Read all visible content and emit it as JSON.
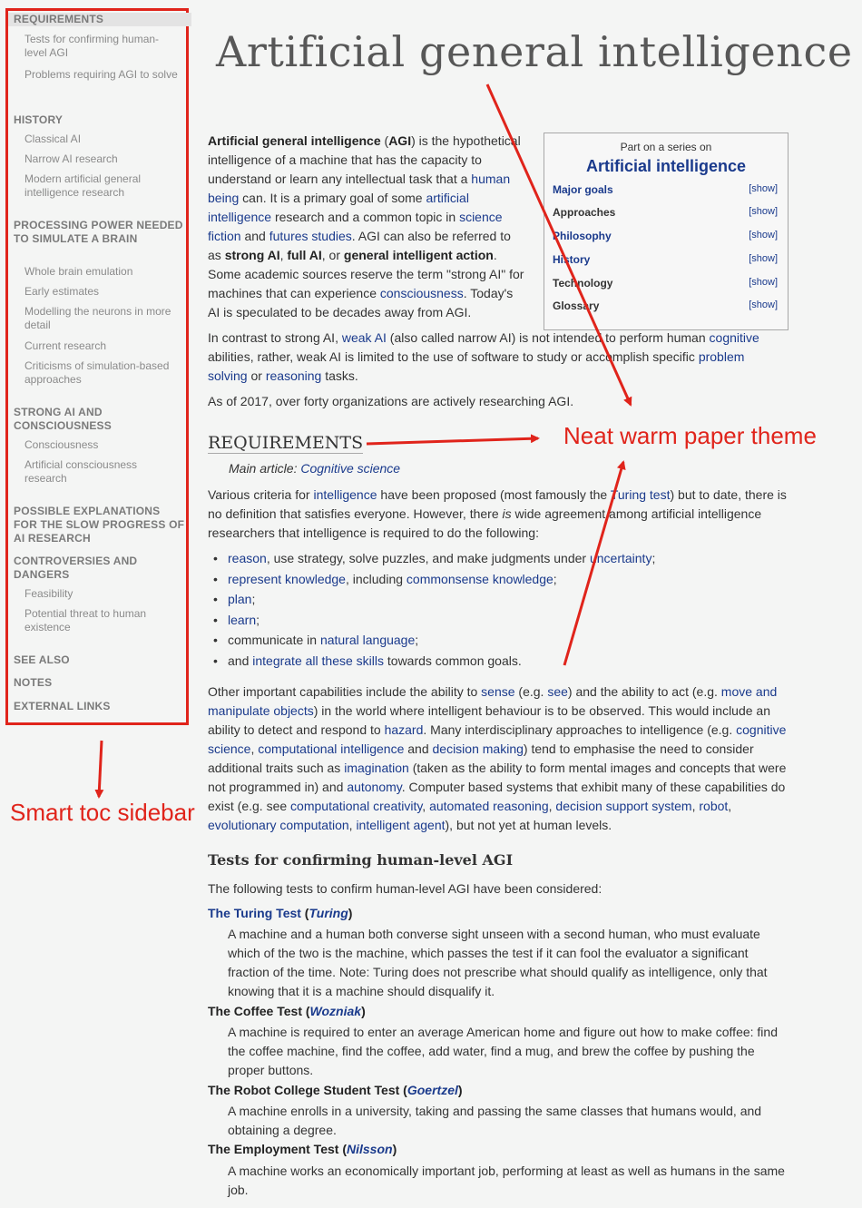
{
  "toc": {
    "items": [
      {
        "type": "sec",
        "label": "REQUIREMENTS",
        "active": true
      },
      {
        "type": "sub",
        "label": "Tests for confirming human-level AGI"
      },
      {
        "type": "sub",
        "label": "Problems requiring AGI to solve"
      },
      {
        "type": "sec",
        "label": "HISTORY"
      },
      {
        "type": "sub",
        "label": "Classical AI"
      },
      {
        "type": "sub",
        "label": "Narrow AI research"
      },
      {
        "type": "sub",
        "label": "Modern artificial general intelligence research"
      },
      {
        "type": "sec",
        "label": "PROCESSING POWER NEEDED TO SIMULATE A BRAIN"
      },
      {
        "type": "sub",
        "label": "Whole brain emulation"
      },
      {
        "type": "sub",
        "label": "Early estimates"
      },
      {
        "type": "sub",
        "label": "Modelling the neurons in more detail"
      },
      {
        "type": "sub",
        "label": "Current research"
      },
      {
        "type": "sub",
        "label": "Criticisms of simulation-based approaches"
      },
      {
        "type": "sec",
        "label": "STRONG AI AND CONSCIOUSNESS"
      },
      {
        "type": "sub",
        "label": "Consciousness"
      },
      {
        "type": "sub",
        "label": "Artificial consciousness research"
      },
      {
        "type": "sec",
        "label": "POSSIBLE EXPLANATIONS FOR THE SLOW PROGRESS OF AI RESEARCH"
      },
      {
        "type": "sec",
        "label": "CONTROVERSIES AND DANGERS"
      },
      {
        "type": "sub",
        "label": "Feasibility"
      },
      {
        "type": "sub",
        "label": "Potential threat to human existence"
      },
      {
        "type": "sec",
        "label": "SEE ALSO"
      },
      {
        "type": "sec",
        "label": "NOTES"
      },
      {
        "type": "sec",
        "label": "EXTERNAL LINKS"
      }
    ]
  },
  "article": {
    "title": "Artificial general intelligence",
    "requirements_heading": "REQUIREMENTS",
    "hatnote_prefix": "Main article: ",
    "hatnote_link": "Cognitive science",
    "tests_heading": "Tests for confirming human-level AGI",
    "tests_intro": "The following tests to confirm human-level AGI have been considered:",
    "requirement_items": [
      [
        {
          "t": "reason",
          "l": true
        },
        {
          "t": ", use strategy, solve puzzles, and make judgments under "
        },
        {
          "t": "uncertainty",
          "l": true
        },
        {
          "t": ";"
        }
      ],
      [
        {
          "t": "represent knowledge",
          "l": true
        },
        {
          "t": ", including "
        },
        {
          "t": "commonsense knowledge",
          "l": true
        },
        {
          "t": ";"
        }
      ],
      [
        {
          "t": "plan",
          "l": true
        },
        {
          "t": ";"
        }
      ],
      [
        {
          "t": "learn",
          "l": true
        },
        {
          "t": ";"
        }
      ],
      [
        {
          "t": "communicate in "
        },
        {
          "t": "natural language",
          "l": true
        },
        {
          "t": ";"
        }
      ],
      [
        {
          "t": "and "
        },
        {
          "t": "integrate all these skills",
          "l": true
        },
        {
          "t": " towards common goals."
        }
      ]
    ],
    "tests": [
      {
        "name": "The Turing Test",
        "by": "Turing",
        "name_link": true,
        "desc": "A machine and a human both converse sight unseen with a second human, who must evaluate which of the two is the machine, which passes the test if it can fool the evaluator a significant fraction of the time. Note: Turing does not prescribe what should qualify as intelligence, only that knowing that it is a machine should disqualify it."
      },
      {
        "name": "The Coffee Test",
        "by": "Wozniak",
        "name_link": false,
        "desc": "A machine is required to enter an average American home and figure out how to make coffee: find the coffee machine, find the coffee, add water, find a mug, and brew the coffee by pushing the proper buttons."
      },
      {
        "name": "The Robot College Student Test",
        "by": "Goertzel",
        "name_link": false,
        "desc": "A machine enrolls in a university, taking and passing the same classes that humans would, and obtaining a degree."
      },
      {
        "name": "The Employment Test",
        "by": "Nilsson",
        "name_link": false,
        "desc": "A machine works an economically important job, performing at least as well as humans in the same job."
      }
    ]
  },
  "infobox": {
    "pretitle": "Part on a series on",
    "title": "Artificial intelligence",
    "show_label": "[show]",
    "rows": [
      {
        "label": "Major goals",
        "link": true
      },
      {
        "label": "Approaches",
        "link": false
      },
      {
        "label": "Philosophy",
        "link": true
      },
      {
        "label": "History",
        "link": true
      },
      {
        "label": "Technology",
        "link": false
      },
      {
        "label": "Glossary",
        "link": false
      }
    ]
  },
  "annotations": {
    "theme_label": "Neat warm paper theme",
    "toc_label": "Smart toc sidebar",
    "color": "#e0241b"
  }
}
